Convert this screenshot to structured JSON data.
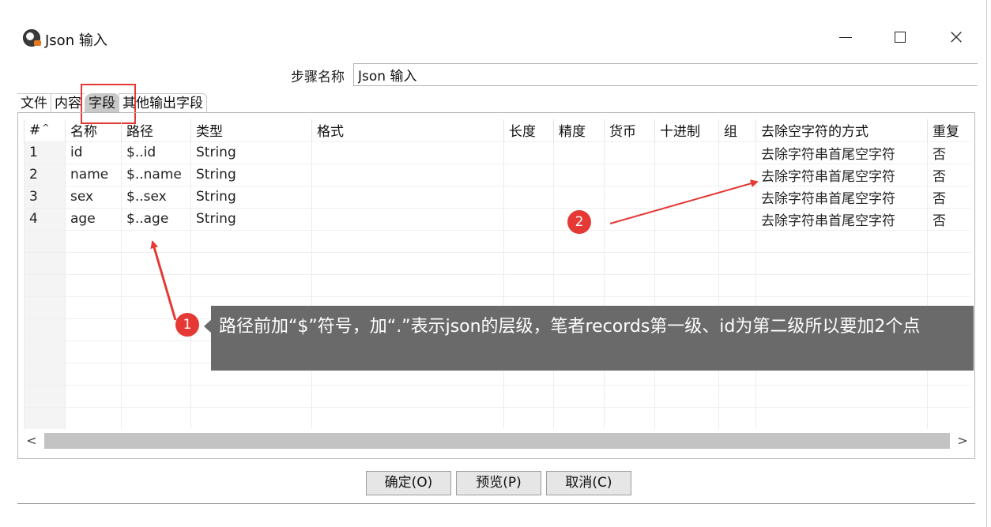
{
  "window": {
    "title": "Json 输入"
  },
  "step": {
    "label": "步骤名称",
    "value": "Json 输入"
  },
  "tabs": [
    {
      "label": "文件"
    },
    {
      "label": "内容"
    },
    {
      "label": "字段",
      "active": true
    },
    {
      "label": "其他输出字段"
    }
  ],
  "table": {
    "headers": [
      "#",
      "名称",
      "路径",
      "类型",
      "格式",
      "长度",
      "精度",
      "货币",
      "十进制",
      "组",
      "去除空字符的方式",
      "重复"
    ],
    "rows": [
      [
        "1",
        "id",
        "$..id",
        "String",
        "",
        "",
        "",
        "",
        "",
        "",
        "去除字符串首尾空字符",
        "否"
      ],
      [
        "2",
        "name",
        "$..name",
        "String",
        "",
        "",
        "",
        "",
        "",
        "",
        "去除字符串首尾空字符",
        "否"
      ],
      [
        "3",
        "sex",
        "$..sex",
        "String",
        "",
        "",
        "",
        "",
        "",
        "",
        "去除字符串首尾空字符",
        "否"
      ],
      [
        "4",
        "age",
        "$..age",
        "String",
        "",
        "",
        "",
        "",
        "",
        "",
        "去除字符串首尾空字符",
        "否"
      ]
    ],
    "sort_indicator": "^"
  },
  "scrollbar": {
    "left_arrow": "<",
    "right_arrow": ">"
  },
  "buttons": {
    "ok": "确定(O)",
    "preview": "预览(P)",
    "cancel": "取消(C)"
  },
  "annotations": {
    "badge1": "1",
    "badge2": "2",
    "tooltip": "路径前加“$”符号，加“.”表示json的层级，笔者records第一级、id为第二级所以要加2个点",
    "color": "#e53935",
    "tooltip_bg": "#6a6a6a"
  }
}
